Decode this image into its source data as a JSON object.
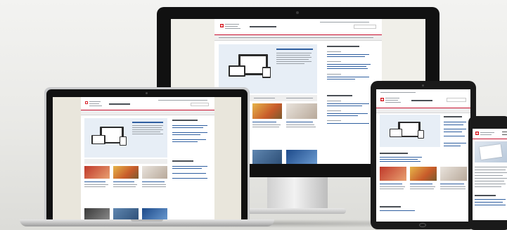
{
  "scene": {
    "background": "#eeeeec",
    "devices": [
      "desktop-monitor",
      "laptop",
      "tablet",
      "smartphone"
    ]
  },
  "site": {
    "accent_color": "#c8102e",
    "link_color": "#2f5fa0",
    "logo": "swiss-cross-icon"
  }
}
